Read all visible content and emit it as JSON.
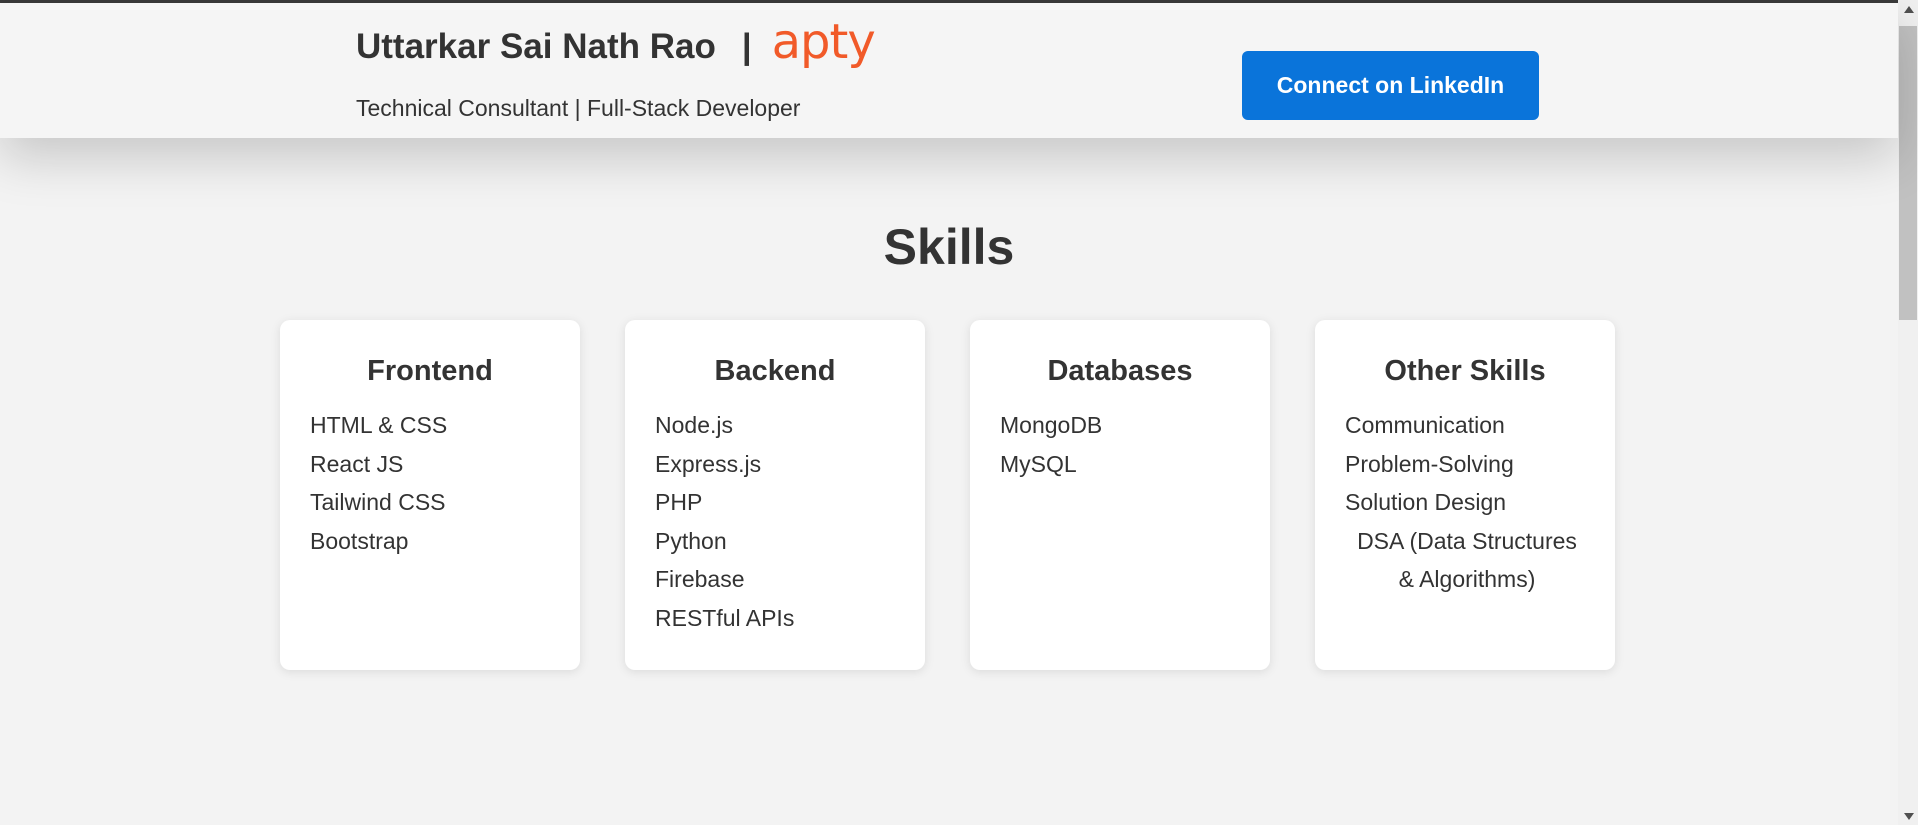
{
  "header": {
    "name": "Uttarkar Sai Nath Rao",
    "separator": "|",
    "brand": "apty",
    "subtitle": "Technical Consultant | Full-Stack Developer",
    "linkedin_label": "Connect on LinkedIn"
  },
  "skills": {
    "title": "Skills",
    "categories": [
      {
        "title": "Frontend",
        "items": [
          "HTML & CSS",
          "React JS",
          "Tailwind CSS",
          "Bootstrap"
        ]
      },
      {
        "title": "Backend",
        "items": [
          "Node.js",
          "Express.js",
          "PHP",
          "Python",
          "Firebase",
          "RESTful APIs"
        ]
      },
      {
        "title": "Databases",
        "items": [
          "MongoDB",
          "MySQL"
        ]
      },
      {
        "title": "Other Skills",
        "items": [
          "Communication",
          "Problem-Solving",
          "Solution Design",
          "DSA (Data Structures & Algorithms)"
        ]
      }
    ]
  },
  "colors": {
    "brand": "#f15a29",
    "button": "#0a74da",
    "text": "#333333",
    "background": "#f3f3f3"
  }
}
